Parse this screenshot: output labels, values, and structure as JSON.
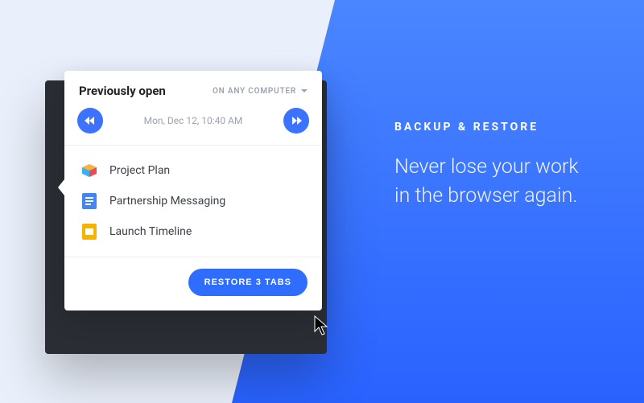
{
  "card": {
    "title": "Previously open",
    "filter_label": "ON ANY COMPUTER",
    "timestamp": "Mon, Dec 12, 10:40 AM",
    "items": [
      {
        "label": "Project Plan"
      },
      {
        "label": "Partnership Messaging"
      },
      {
        "label": "Launch Timeline"
      }
    ],
    "restore_label": "RESTORE 3 TABS"
  },
  "promo": {
    "heading": "BACKUP & RESTORE",
    "body": "Never lose your work in the browser again."
  }
}
